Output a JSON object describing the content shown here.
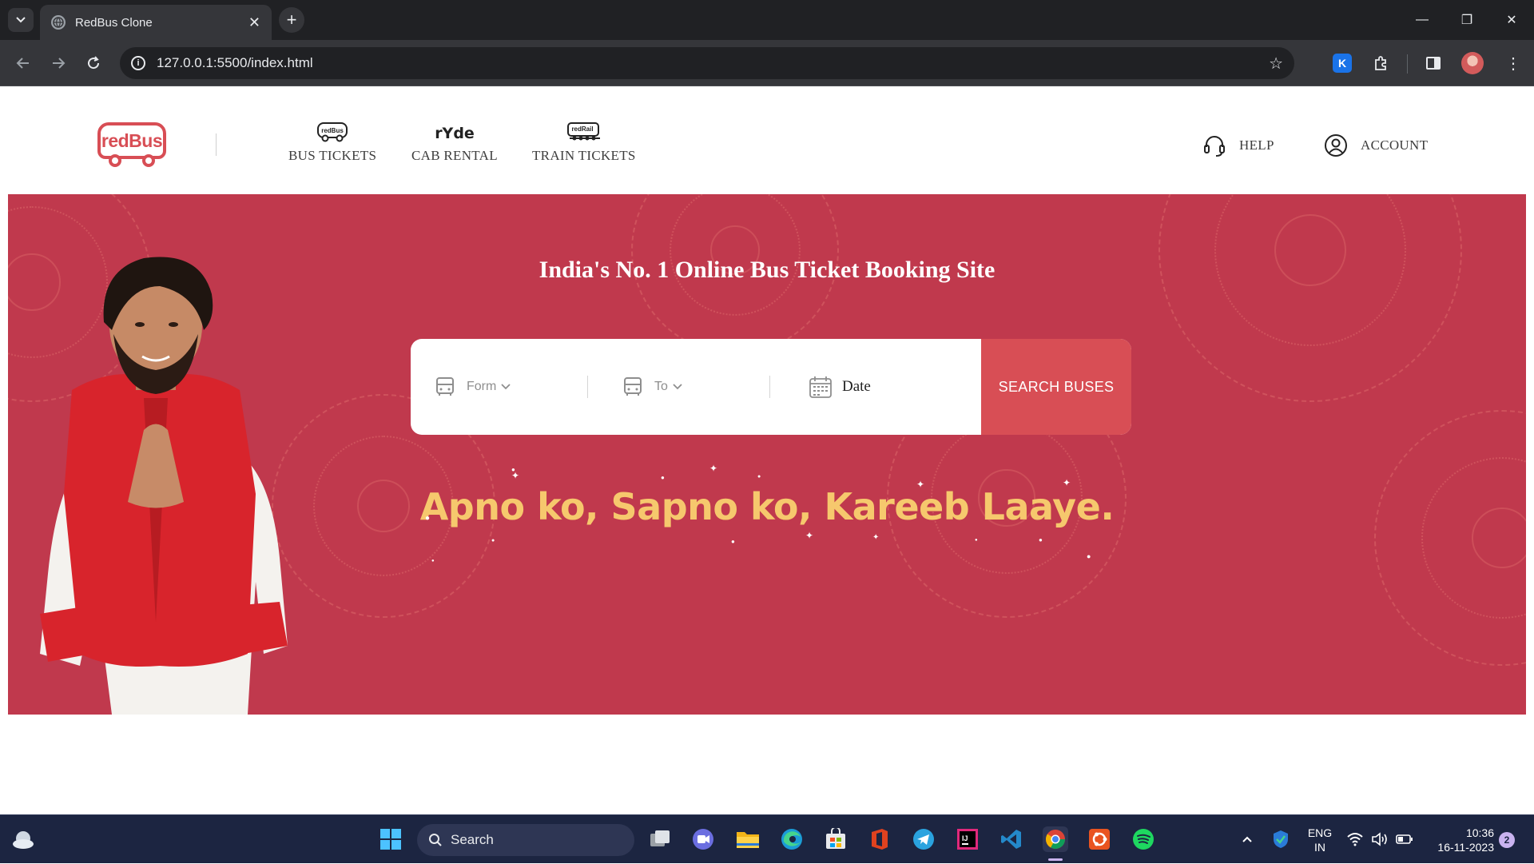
{
  "browser": {
    "tab_title": "RedBus Clone",
    "tab_close": "✕",
    "new_tab": "+",
    "url": "127.0.0.1:5500/index.html",
    "window_controls": {
      "minimize": "—",
      "restore": "❐",
      "close": "✕"
    },
    "extension_k": "K"
  },
  "site": {
    "logo_text": "redBus",
    "nav": [
      {
        "label": "BUS TICKETS",
        "icon": "redbus-bus-icon",
        "icon_text": "redBus"
      },
      {
        "label": "CAB RENTAL",
        "icon": "ryde-icon",
        "icon_text": "rYde"
      },
      {
        "label": "TRAIN TICKETS",
        "icon": "redrail-train-icon",
        "icon_text": "redRail"
      }
    ],
    "help_label": "HELP",
    "account_label": "ACCOUNT"
  },
  "hero": {
    "title": "India's No. 1 Online Bus Ticket Booking Site",
    "from_placeholder": "Form",
    "to_placeholder": "To",
    "date_placeholder": "Date",
    "search_button": "SEARCH BUSES",
    "tagline": "Apno ko, Sapno ko, Kareeb Laaye.",
    "background_color": "#c0394d",
    "accent_color": "#d84e55",
    "tagline_color": "#f6c86d"
  },
  "taskbar": {
    "search_label": "Search",
    "language": [
      "ENG",
      "IN"
    ],
    "time": "10:36",
    "date": "16-11-2023",
    "notification_count": "2"
  }
}
